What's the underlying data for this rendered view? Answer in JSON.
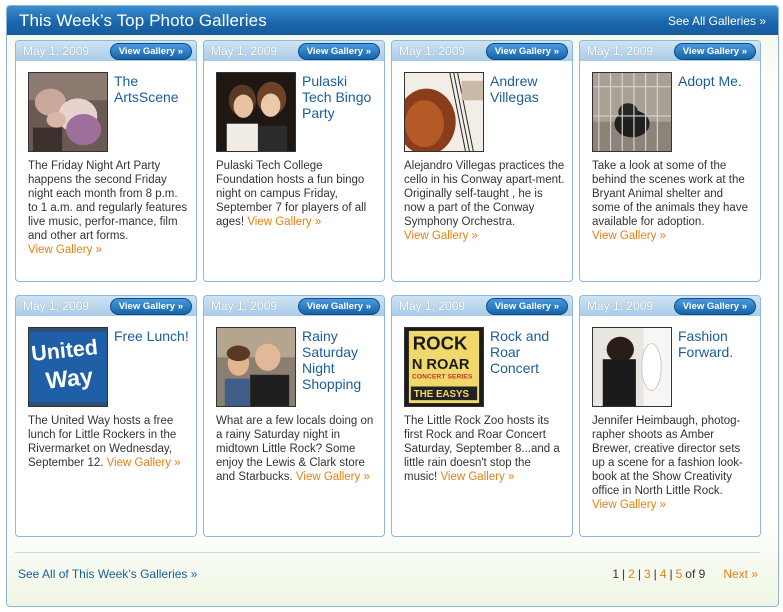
{
  "header": {
    "title": "This Week’s Top Photo Galleries",
    "see_all": "See All Galleries »"
  },
  "common": {
    "view_gallery_button": "View Gallery »",
    "view_gallery_link": "View Gallery »"
  },
  "galleries": [
    {
      "date": "May 1, 2009",
      "title": "The ArtsScene",
      "description": "The Friday Night Art Party happens the second Friday night each month from 8 p.m. to 1 a.m. and regularly features live music, perfor-mance, film and other art forms.",
      "thumb_icon": "art-crowd-photo"
    },
    {
      "date": "May 1, 2009",
      "title": "Pulaski Tech Bingo Party",
      "description": "Pulaski Tech College Foundation hosts a fun bingo night on campus Friday, September 7 for players of all ages!",
      "thumb_icon": "two-women-photo"
    },
    {
      "date": "May 1, 2009",
      "title": "Andrew Villegas",
      "description": "Alejandro Villegas practices the cello in his Conway apart-ment. Originally self-taught , he is now a part of the Conway Symphony Orchestra.",
      "thumb_icon": "cello-photo"
    },
    {
      "date": "May 1, 2009",
      "title": "Adopt Me.",
      "description": "Take a look at some of the behind the scenes work at the Bryant Animal shelter and some of the animals they have available for adoption.",
      "thumb_icon": "shelter-dog-photo"
    },
    {
      "date": "May 1, 2009",
      "title": "Free Lunch!",
      "description": "The United Way hosts a free lunch for Little Rockers in the Rivermarket on Wednesday, September 12.",
      "thumb_icon": "united-way-banner-photo",
      "thumb_text_1": "United",
      "thumb_text_2": "Way"
    },
    {
      "date": "May 1, 2009",
      "title": "Rainy Saturday Night Shopping",
      "description": "What are a few locals doing on a rainy Saturday night in midtown Little Rock? Some enjoy the Lewis & Clark store and Starbucks.",
      "thumb_icon": "couple-photo"
    },
    {
      "date": "May 1, 2009",
      "title": "Rock and Roar Concert",
      "description": "The Little Rock Zoo hosts its first Rock and Roar Concert Saturday, September 8...and a little rain doesn't stop the music!",
      "thumb_icon": "concert-poster-photo",
      "thumb_text_1": "ROCK",
      "thumb_text_2": "N ROAR",
      "thumb_text_3": "CONCERT SERIES",
      "thumb_text_4": "THE EASYS"
    },
    {
      "date": "May 1, 2009",
      "title": "Fashion Forward.",
      "description": "Jennifer Heimbaugh, photog-rapher shoots as Amber Brewer, creative director sets up a scene for a fashion look-book at the Show Creativity office in North Little Rock.",
      "thumb_icon": "fashion-shoot-photo"
    }
  ],
  "footer": {
    "see_all": "See All of This Week’s Galleries »",
    "pager": {
      "current": "1",
      "pages": [
        "2",
        "3",
        "4",
        "5"
      ],
      "separator": "|",
      "of_total": "of 9",
      "next": "Next »"
    }
  },
  "colors": {
    "header_blue": "#1a67ad",
    "title_blue": "#1a5d9c",
    "link_orange": "#e87f13",
    "card_border": "#8db9dc"
  }
}
